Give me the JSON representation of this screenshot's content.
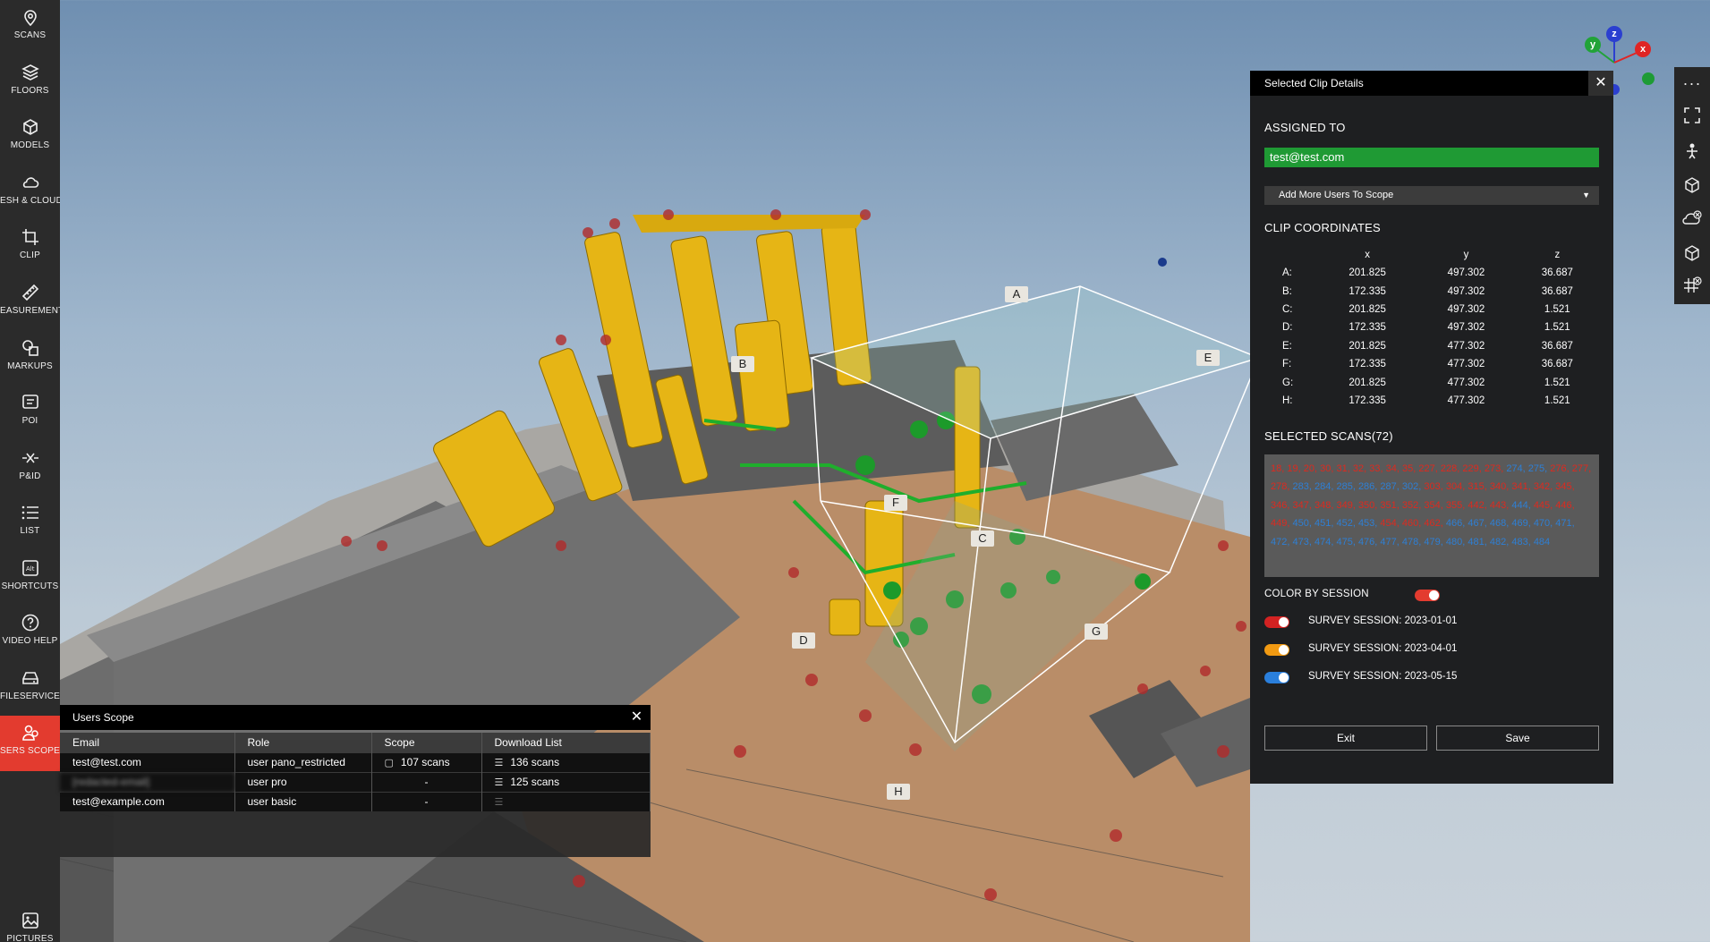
{
  "sidebar": {
    "items": [
      {
        "label": "SCANS",
        "icon": "map-pin-icon"
      },
      {
        "label": "FLOORS",
        "icon": "layers-icon"
      },
      {
        "label": "MODELS",
        "icon": "cube-icon"
      },
      {
        "label": "ESH & CLOUD",
        "icon": "point-cloud-icon"
      },
      {
        "label": "CLIP",
        "icon": "crop-icon"
      },
      {
        "label": "EASUREMENTS",
        "icon": "ruler-icon"
      },
      {
        "label": "MARKUPS",
        "icon": "shapes-icon"
      },
      {
        "label": "POI",
        "icon": "poi-icon"
      },
      {
        "label": "P&ID",
        "icon": "valve-icon"
      },
      {
        "label": "LIST",
        "icon": "list-icon"
      },
      {
        "label": "SHORTCUTS",
        "icon": "keyboard-shortcut-icon"
      },
      {
        "label": "VIDEO HELP",
        "icon": "help-circle-icon"
      },
      {
        "label": "FILESERVICE",
        "icon": "hard-drive-icon"
      },
      {
        "label": "SERS SCOPE",
        "icon": "users-scope-icon"
      },
      {
        "label": "PICTURES",
        "icon": "image-icon"
      }
    ],
    "active_color": "#e33b2f"
  },
  "gizmo": {
    "y": "y",
    "z": "z",
    "x": "x"
  },
  "clip_labels": [
    "A",
    "B",
    "C",
    "D",
    "E",
    "F",
    "G",
    "H"
  ],
  "clip_panel": {
    "title": "Selected Clip Details",
    "close": "✕",
    "assigned_to_title": "ASSIGNED TO",
    "assigned_user": "test@test.com",
    "add_users_label": "Add More Users To Scope",
    "coords_title": "CLIP COORDINATES",
    "coord_headers": [
      "x",
      "y",
      "z"
    ],
    "coordinates": [
      {
        "point": "A:",
        "x": "201.825",
        "y": "497.302",
        "z": "36.687"
      },
      {
        "point": "B:",
        "x": "172.335",
        "y": "497.302",
        "z": "36.687"
      },
      {
        "point": "C:",
        "x": "201.825",
        "y": "497.302",
        "z": "1.521"
      },
      {
        "point": "D:",
        "x": "172.335",
        "y": "497.302",
        "z": "1.521"
      },
      {
        "point": "E:",
        "x": "201.825",
        "y": "477.302",
        "z": "36.687"
      },
      {
        "point": "F:",
        "x": "172.335",
        "y": "477.302",
        "z": "36.687"
      },
      {
        "point": "G:",
        "x": "201.825",
        "y": "477.302",
        "z": "1.521"
      },
      {
        "point": "H:",
        "x": "172.335",
        "y": "477.302",
        "z": "1.521"
      }
    ],
    "selected_scans_title": "SELECTED SCANS(72)",
    "scans": {
      "red": [
        "18",
        "19",
        "20",
        "30",
        "31",
        "32",
        "33",
        "34",
        "35",
        "227",
        "228",
        "229",
        "273",
        "276",
        "277",
        "278",
        "303",
        "304",
        "315",
        "340",
        "341",
        "342",
        "345",
        "346",
        "347",
        "348",
        "349",
        "350",
        "351",
        "352",
        "354",
        "355",
        "442",
        "443",
        "445",
        "446",
        "449",
        "454",
        "460",
        "462"
      ],
      "blue": [
        "274",
        "275",
        "283",
        "284",
        "285",
        "286",
        "287",
        "302",
        "444",
        "450",
        "451",
        "452",
        "453",
        "466",
        "467",
        "468",
        "469",
        "470",
        "471",
        "472",
        "473",
        "474",
        "475",
        "476",
        "477",
        "478",
        "479",
        "480",
        "481",
        "482",
        "483",
        "484"
      ]
    },
    "color_by_session_label": "COLOR BY SESSION",
    "sessions": [
      {
        "label": "SURVEY SESSION: 2023-01-01",
        "color": "#d32222"
      },
      {
        "label": "SURVEY SESSION: 2023-04-01",
        "color": "#f29a12"
      },
      {
        "label": "SURVEY SESSION: 2023-05-15",
        "color": "#2a7fdc"
      }
    ],
    "exit_label": "Exit",
    "save_label": "Save"
  },
  "users_scope": {
    "title": "Users Scope",
    "close": "✕",
    "headers": [
      "Email",
      "Role",
      "Scope",
      "Download List"
    ],
    "rows": [
      {
        "email": "test@test.com",
        "role": "user pano_restricted",
        "scope": "107 scans",
        "download": "136 scans"
      },
      {
        "email": "[redacted-email]",
        "role": "user pro",
        "scope": "-",
        "download": "125 scans"
      },
      {
        "email": "test@example.com",
        "role": "user basic",
        "scope": "-",
        "download": ""
      }
    ]
  }
}
